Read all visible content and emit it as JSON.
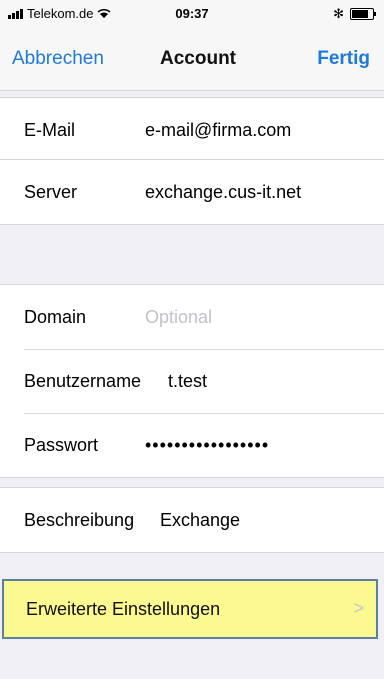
{
  "status": {
    "carrier": "Telekom.de",
    "time": "09:37"
  },
  "nav": {
    "cancel": "Abbrechen",
    "title": "Account",
    "done": "Fertig"
  },
  "fields": {
    "email": {
      "label": "E-Mail",
      "value": "e-mail@firma.com"
    },
    "server": {
      "label": "Server",
      "value": "exchange.cus-it.net"
    },
    "domain": {
      "label": "Domain",
      "placeholder": "Optional"
    },
    "username": {
      "label": "Benutzername",
      "value": "t.test"
    },
    "password": {
      "label": "Passwort",
      "value": "•••••••••••••••••"
    },
    "description": {
      "label": "Beschreibung",
      "value": "Exchange"
    }
  },
  "advanced": {
    "label": "Erweiterte Einstellungen"
  },
  "colors": {
    "accent": "#1f7ae0",
    "highlight": "#fbf98f",
    "background": "#efeff4"
  }
}
